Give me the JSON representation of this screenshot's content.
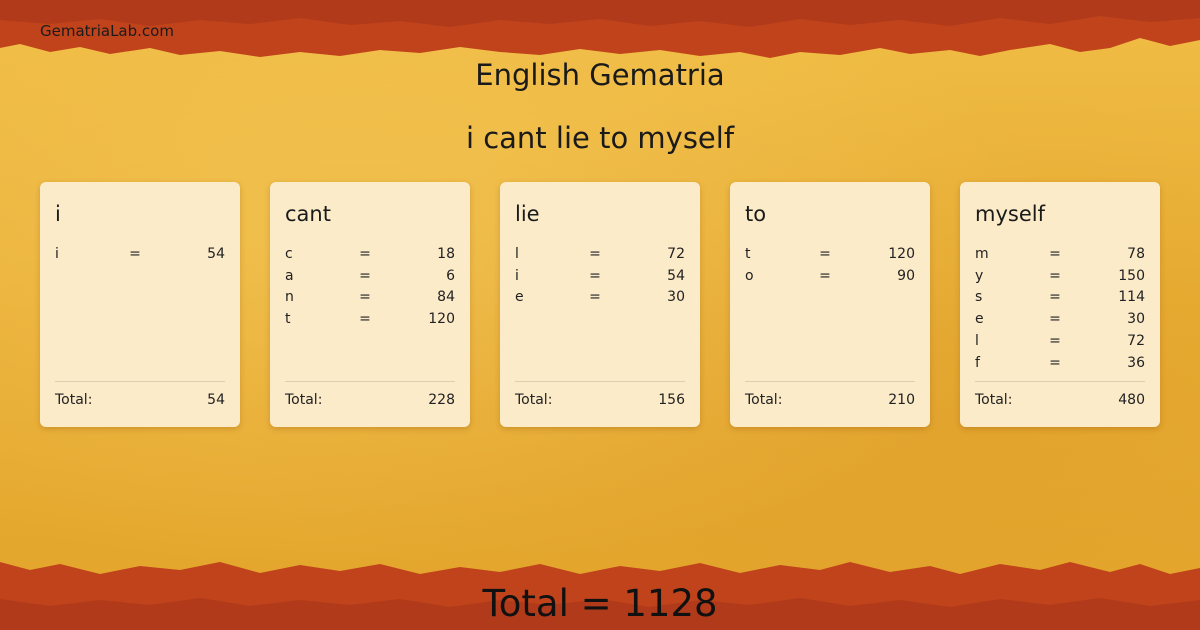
{
  "site": "GematriaLab.com",
  "title": "English Gematria",
  "phrase": "i cant lie to myself",
  "total_label": "Total:",
  "eq": "=",
  "words": [
    {
      "word": "i",
      "letters": [
        {
          "l": "i",
          "v": "54"
        }
      ],
      "total": "54"
    },
    {
      "word": "cant",
      "letters": [
        {
          "l": "c",
          "v": "18"
        },
        {
          "l": "a",
          "v": "6"
        },
        {
          "l": "n",
          "v": "84"
        },
        {
          "l": "t",
          "v": "120"
        }
      ],
      "total": "228"
    },
    {
      "word": "lie",
      "letters": [
        {
          "l": "l",
          "v": "72"
        },
        {
          "l": "i",
          "v": "54"
        },
        {
          "l": "e",
          "v": "30"
        }
      ],
      "total": "156"
    },
    {
      "word": "to",
      "letters": [
        {
          "l": "t",
          "v": "120"
        },
        {
          "l": "o",
          "v": "90"
        }
      ],
      "total": "210"
    },
    {
      "word": "myself",
      "letters": [
        {
          "l": "m",
          "v": "78"
        },
        {
          "l": "y",
          "v": "150"
        },
        {
          "l": "s",
          "v": "114"
        },
        {
          "l": "e",
          "v": "30"
        },
        {
          "l": "l",
          "v": "72"
        },
        {
          "l": "f",
          "v": "36"
        }
      ],
      "total": "480"
    }
  ],
  "grand_total": "Total = 1128",
  "colors": {
    "edge": "#c0431b",
    "edge_dark": "#8f2a10",
    "background": "#e9b33a",
    "card": "#fbebc9"
  }
}
